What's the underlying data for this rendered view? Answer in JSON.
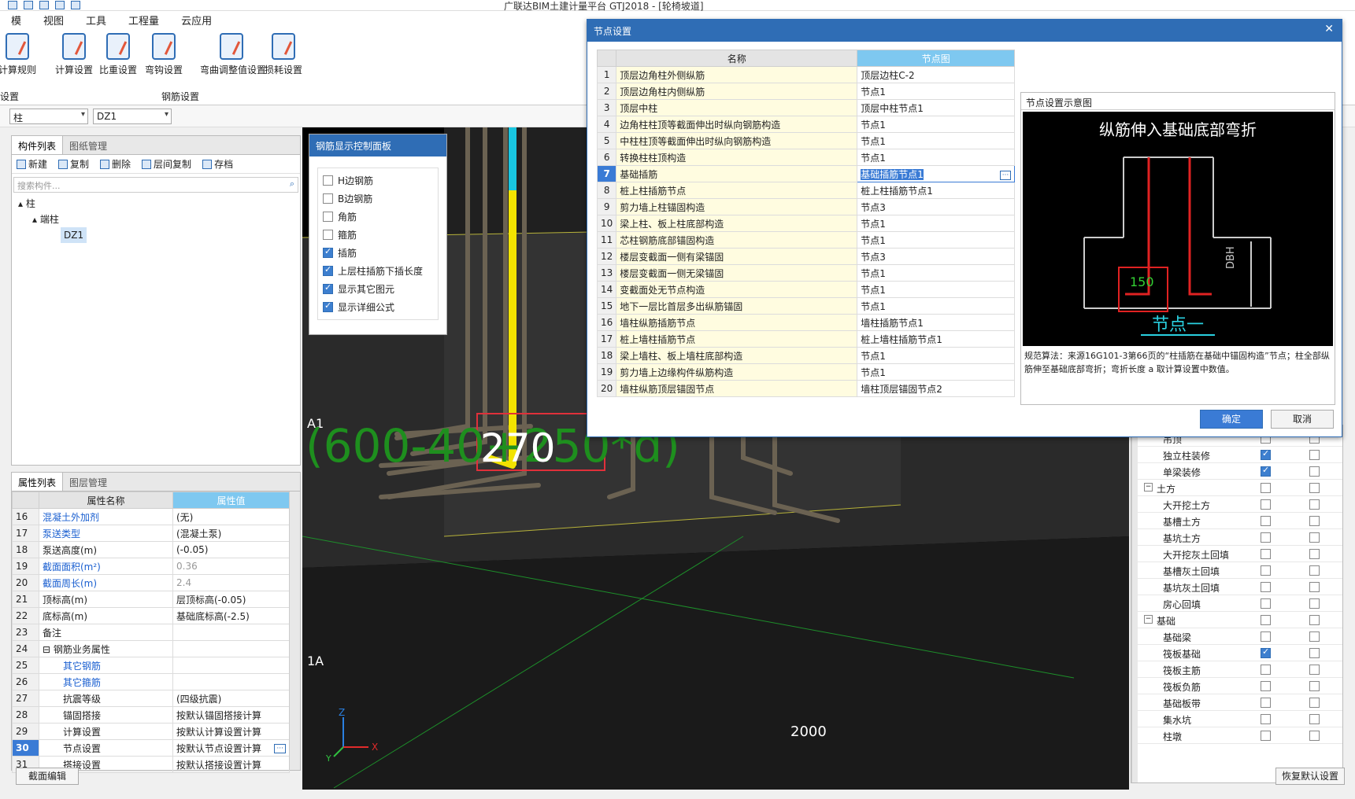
{
  "app": {
    "title": "广联达BIM土建计量平台 GTJ2018 - [轮椅坡道]"
  },
  "menu": [
    "模",
    "视图",
    "工具",
    "工程量",
    "云应用"
  ],
  "ribbon": {
    "left_button": "计算规则",
    "left_group": "设置",
    "buttons": [
      "计算设置",
      "比重设置",
      "弯钩设置",
      "弯曲调整值设置",
      "损耗设置"
    ],
    "group_label": "钢筋设置"
  },
  "filters": {
    "combo1": "柱",
    "combo2": "DZ1"
  },
  "component_panel": {
    "tabs": [
      "构件列表",
      "图纸管理"
    ],
    "toolbar": [
      "新建",
      "复制",
      "删除",
      "层间复制",
      "存档"
    ],
    "search_placeholder": "搜索构件...",
    "tree": [
      "柱",
      "端柱",
      "DZ1"
    ]
  },
  "props_panel": {
    "tabs": [
      "属性列表",
      "图层管理"
    ],
    "headers": [
      "属性名称",
      "属性值"
    ],
    "rows": [
      {
        "n": "16",
        "name": "混凝土外加剂",
        "value": "(无)",
        "link": true
      },
      {
        "n": "17",
        "name": "泵送类型",
        "value": "(混凝土泵)",
        "link": true
      },
      {
        "n": "18",
        "name": "泵送高度(m)",
        "value": "(-0.05)",
        "link": false
      },
      {
        "n": "19",
        "name": "截面面积(m²)",
        "value": "0.36",
        "link": true,
        "grey": true
      },
      {
        "n": "20",
        "name": "截面周长(m)",
        "value": "2.4",
        "link": true,
        "grey": true
      },
      {
        "n": "21",
        "name": "顶标高(m)",
        "value": "层顶标高(-0.05)",
        "link": false
      },
      {
        "n": "22",
        "name": "底标高(m)",
        "value": "基础底标高(-2.5)",
        "link": false
      },
      {
        "n": "23",
        "name": "备注",
        "value": "",
        "link": false
      },
      {
        "n": "24",
        "name": "⊟ 钢筋业务属性",
        "value": "",
        "link": false
      },
      {
        "n": "25",
        "name": "其它钢筋",
        "value": "",
        "link": true,
        "indent": true
      },
      {
        "n": "26",
        "name": "其它箍筋",
        "value": "",
        "link": true,
        "indent": true
      },
      {
        "n": "27",
        "name": "抗震等级",
        "value": "(四级抗震)",
        "link": false,
        "indent": true
      },
      {
        "n": "28",
        "name": "锚固搭接",
        "value": "按默认锚固搭接计算",
        "link": false,
        "indent": true
      },
      {
        "n": "29",
        "name": "计算设置",
        "value": "按默认计算设置计算",
        "link": false,
        "indent": true
      },
      {
        "n": "30",
        "name": "节点设置",
        "value": "按默认节点设置计算",
        "link": false,
        "indent": true,
        "selected": true
      },
      {
        "n": "31",
        "name": "搭接设置",
        "value": "按默认搭接设置计算",
        "link": false,
        "indent": true
      }
    ],
    "bottom_button": "截面编辑"
  },
  "rebar_panel": {
    "title": "钢筋显示控制面板",
    "items": [
      {
        "label": "H边钢筋",
        "checked": false
      },
      {
        "label": "B边钢筋",
        "checked": false
      },
      {
        "label": "角筋",
        "checked": false
      },
      {
        "label": "箍筋",
        "checked": false
      },
      {
        "label": "插筋",
        "checked": true
      },
      {
        "label": "上层柱插筋下插长度",
        "checked": true
      },
      {
        "label": "显示其它图元",
        "checked": true
      },
      {
        "label": "显示详细公式",
        "checked": true
      }
    ]
  },
  "viewport": {
    "grid_a1": "A1",
    "grid_1a": "1A",
    "formula": "(600-40+250*d)",
    "dim_label": "270",
    "dim_2000": "2000",
    "axis_x": "X",
    "axis_z": "Z",
    "axis_y": "Y"
  },
  "right_panel": {
    "rows": [
      {
        "label": "吊顶",
        "indent": 2,
        "c1": false,
        "c2": false
      },
      {
        "label": "独立柱装修",
        "indent": 2,
        "c1": true,
        "c2": false
      },
      {
        "label": "单梁装修",
        "indent": 2,
        "c1": true,
        "c2": false
      },
      {
        "label": "土方",
        "indent": 1,
        "group": true,
        "c1": false,
        "c2": false
      },
      {
        "label": "大开挖土方",
        "indent": 2,
        "c1": false,
        "c2": false
      },
      {
        "label": "基槽土方",
        "indent": 2,
        "c1": false,
        "c2": false
      },
      {
        "label": "基坑土方",
        "indent": 2,
        "c1": false,
        "c2": false
      },
      {
        "label": "大开挖灰土回填",
        "indent": 2,
        "c1": false,
        "c2": false
      },
      {
        "label": "基槽灰土回填",
        "indent": 2,
        "c1": false,
        "c2": false
      },
      {
        "label": "基坑灰土回填",
        "indent": 2,
        "c1": false,
        "c2": false
      },
      {
        "label": "房心回填",
        "indent": 2,
        "c1": false,
        "c2": false
      },
      {
        "label": "基础",
        "indent": 1,
        "group": true,
        "c1": false,
        "c2": false
      },
      {
        "label": "基础梁",
        "indent": 2,
        "c1": false,
        "c2": false
      },
      {
        "label": "筏板基础",
        "indent": 2,
        "c1": true,
        "c2": false
      },
      {
        "label": "筏板主筋",
        "indent": 2,
        "c1": false,
        "c2": false
      },
      {
        "label": "筏板负筋",
        "indent": 2,
        "c1": false,
        "c2": false
      },
      {
        "label": "基础板带",
        "indent": 2,
        "c1": false,
        "c2": false
      },
      {
        "label": "集水坑",
        "indent": 2,
        "c1": false,
        "c2": false
      },
      {
        "label": "柱墩",
        "indent": 2,
        "c1": false,
        "c2": false
      }
    ],
    "restore_button": "恢复默认设置"
  },
  "dialog": {
    "title": "节点设置",
    "close": "✕",
    "headers": [
      "名称",
      "节点图"
    ],
    "rows": [
      {
        "n": "1",
        "name": "顶层边角柱外侧纵筋",
        "value": "顶层边柱C-2"
      },
      {
        "n": "2",
        "name": "顶层边角柱内侧纵筋",
        "value": "节点1"
      },
      {
        "n": "3",
        "name": "顶层中柱",
        "value": "顶层中柱节点1"
      },
      {
        "n": "4",
        "name": "边角柱柱顶等截面伸出时纵向钢筋构造",
        "value": "节点1"
      },
      {
        "n": "5",
        "name": "中柱柱顶等截面伸出时纵向钢筋构造",
        "value": "节点1"
      },
      {
        "n": "6",
        "name": "转换柱柱顶构造",
        "value": "节点1"
      },
      {
        "n": "7",
        "name": "基础插筋",
        "value": "基础插筋节点1",
        "active": true
      },
      {
        "n": "8",
        "name": "桩上柱插筋节点",
        "value": "桩上柱插筋节点1"
      },
      {
        "n": "9",
        "name": "剪力墙上柱锚固构造",
        "value": "节点3"
      },
      {
        "n": "10",
        "name": "梁上柱、板上柱底部构造",
        "value": "节点1"
      },
      {
        "n": "11",
        "name": "芯柱钢筋底部锚固构造",
        "value": "节点1"
      },
      {
        "n": "12",
        "name": "楼层变截面一侧有梁锚固",
        "value": "节点3"
      },
      {
        "n": "13",
        "name": "楼层变截面一侧无梁锚固",
        "value": "节点1"
      },
      {
        "n": "14",
        "name": "变截面处无节点构造",
        "value": "节点1"
      },
      {
        "n": "15",
        "name": "地下一层比首层多出纵筋锚固",
        "value": "节点1"
      },
      {
        "n": "16",
        "name": "墙柱纵筋插筋节点",
        "value": "墙柱插筋节点1"
      },
      {
        "n": "17",
        "name": "桩上墙柱插筋节点",
        "value": "桩上墙柱插筋节点1"
      },
      {
        "n": "18",
        "name": "梁上墙柱、板上墙柱底部构造",
        "value": "节点1"
      },
      {
        "n": "19",
        "name": "剪力墙上边缘构件纵筋构造",
        "value": "节点1"
      },
      {
        "n": "20",
        "name": "墙柱纵筋顶层锚固节点",
        "value": "墙柱顶层锚固节点2"
      }
    ],
    "preview": {
      "header": "节点设置示意图",
      "image_title": "纵筋伸入基础底部弯折",
      "dim_150": "150",
      "dim_dbh": "DBH",
      "node_label": "节点一",
      "description": "规范算法：来源16G101-3第66页的“柱插筋在基础中锚固构造”节点；柱全部纵筋伸至基础底部弯折；弯折长度 a 取计算设置中数值。"
    },
    "ok": "确定",
    "cancel": "取消"
  }
}
